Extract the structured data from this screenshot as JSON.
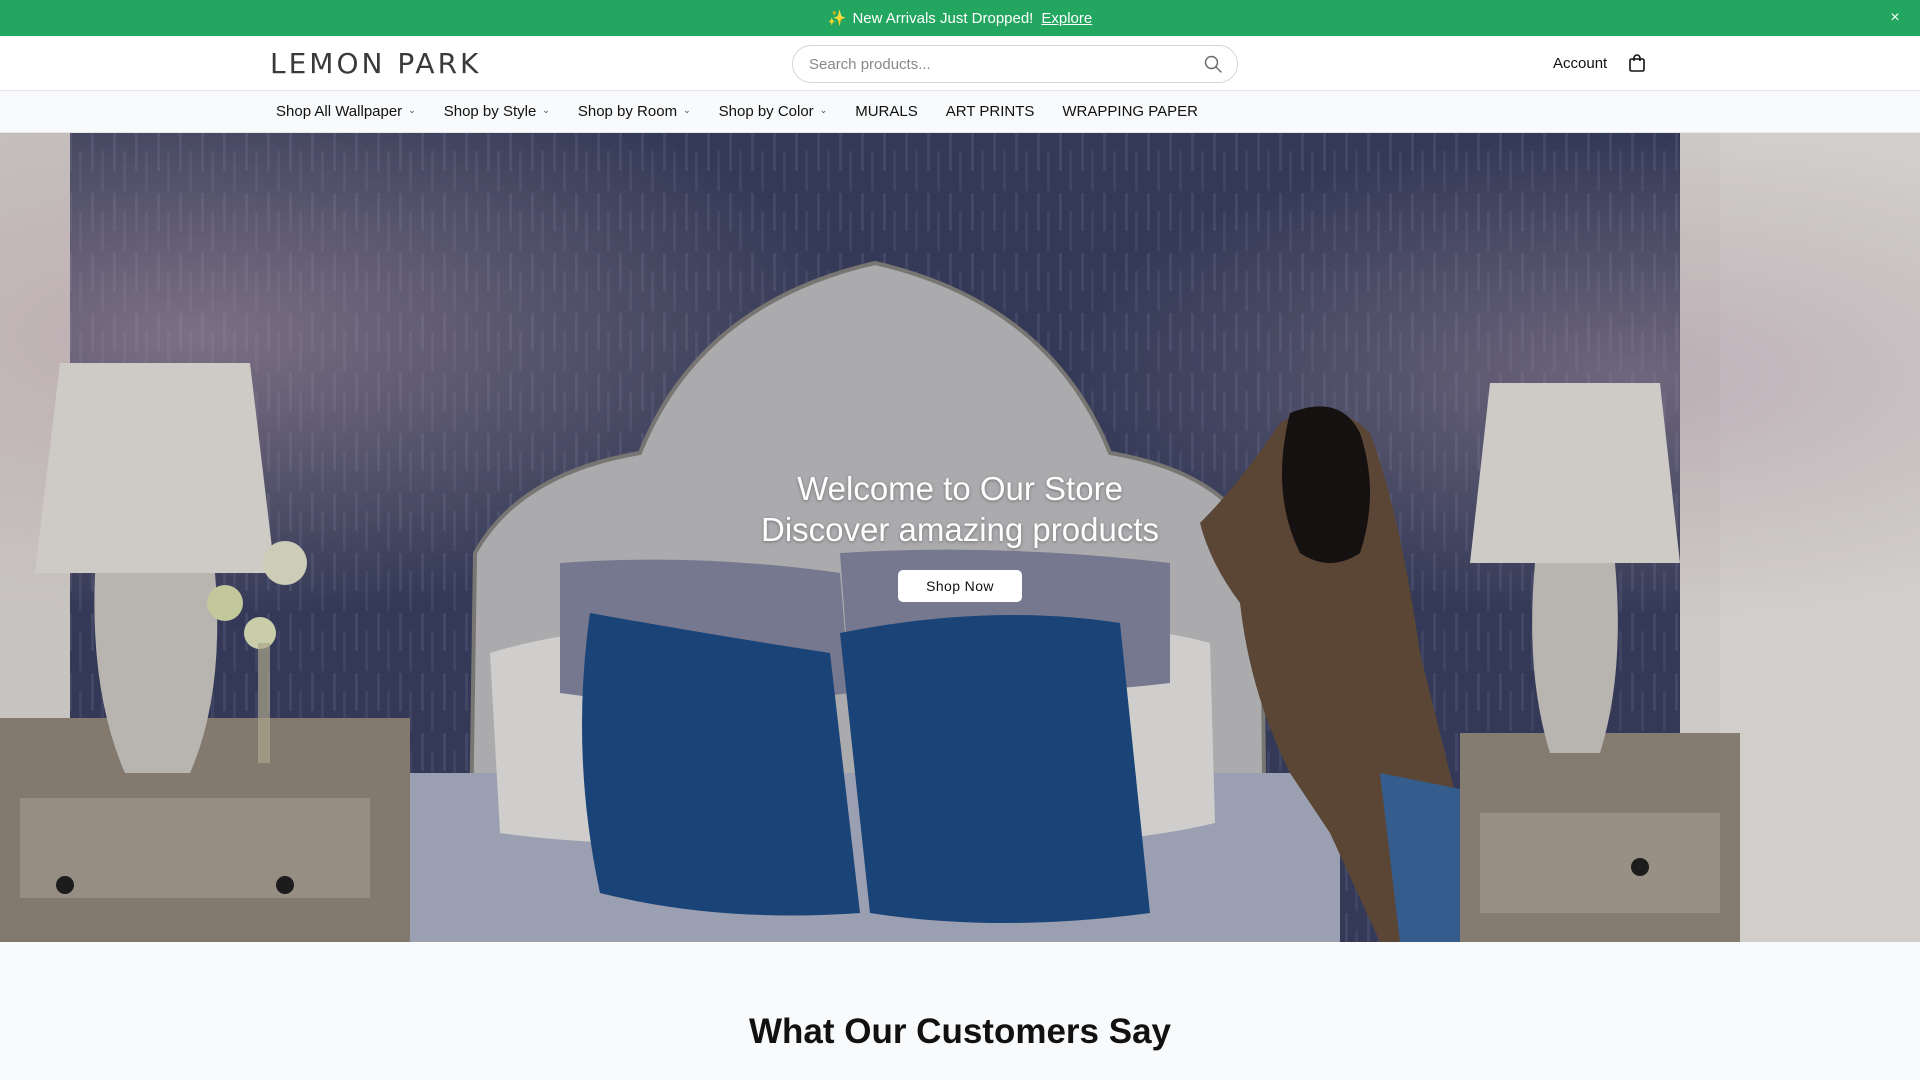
{
  "announcement": {
    "sparkle": "✨",
    "text": "New Arrivals Just Dropped!",
    "link": "Explore",
    "close": "×"
  },
  "header": {
    "logo": "LEMON PARK",
    "search_placeholder": "Search products...",
    "account": "Account"
  },
  "nav": {
    "items": [
      {
        "label": "Shop All Wallpaper",
        "has_dropdown": true
      },
      {
        "label": "Shop by Style",
        "has_dropdown": true
      },
      {
        "label": "Shop by Room",
        "has_dropdown": true
      },
      {
        "label": "Shop by Color",
        "has_dropdown": true
      },
      {
        "label": "MURALS",
        "has_dropdown": false
      },
      {
        "label": "ART PRINTS",
        "has_dropdown": false
      },
      {
        "label": "WRAPPING PAPER",
        "has_dropdown": false
      }
    ]
  },
  "hero": {
    "title_line1": "Welcome to Our Store",
    "title_line2": "Discover amazing products",
    "button": "Shop Now"
  },
  "testimonials": {
    "title": "What Our Customers Say"
  },
  "colors": {
    "announcement_bg": "#22a660",
    "wallpaper": "#3f4766",
    "pillow_blue": "#1f4f8c"
  }
}
